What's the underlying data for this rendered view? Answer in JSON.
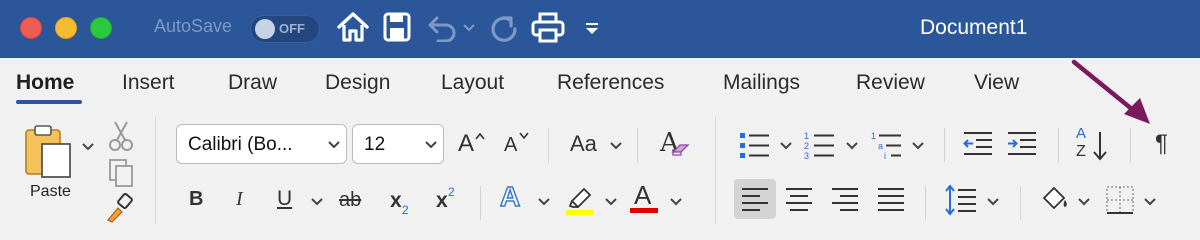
{
  "window": {
    "title": "Document1",
    "autosave_label": "AutoSave",
    "autosave_state": "OFF"
  },
  "quick_access_icons": [
    "home-icon",
    "save-icon",
    "undo-icon",
    "undo-dropdown-icon",
    "redo-icon",
    "print-icon",
    "customize-toolbar-icon"
  ],
  "tabs": [
    {
      "label": "Home",
      "active": true
    },
    {
      "label": "Insert"
    },
    {
      "label": "Draw"
    },
    {
      "label": "Design"
    },
    {
      "label": "Layout"
    },
    {
      "label": "References"
    },
    {
      "label": "Mailings"
    },
    {
      "label": "Review"
    },
    {
      "label": "View"
    }
  ],
  "clipboard": {
    "paste_label": "Paste"
  },
  "font": {
    "family": "Calibri (Bo...",
    "size": "12",
    "bold": "B",
    "italic": "I",
    "underline": "U",
    "strikethrough": "ab",
    "subscript_base": "x",
    "subscript_mark": "2",
    "superscript_base": "x",
    "superscript_mark": "2",
    "text_effects": "A",
    "font_color": "A",
    "grow_font": "A",
    "shrink_font": "A",
    "change_case": "Aa",
    "clear_formatting": "A"
  },
  "paragraph": {
    "sort_top": "A",
    "sort_bottom": "Z",
    "show_marks": "¶"
  },
  "colors": {
    "titlebar": "#2b579a",
    "highlight": "#ffff00",
    "font_color_bar": "#e00000",
    "text_effects": "#3a78c9",
    "annotation_arrow": "#7a1a5c",
    "close": "#ee5c54",
    "minimize": "#f5bc2f",
    "maximize": "#2bc840"
  }
}
